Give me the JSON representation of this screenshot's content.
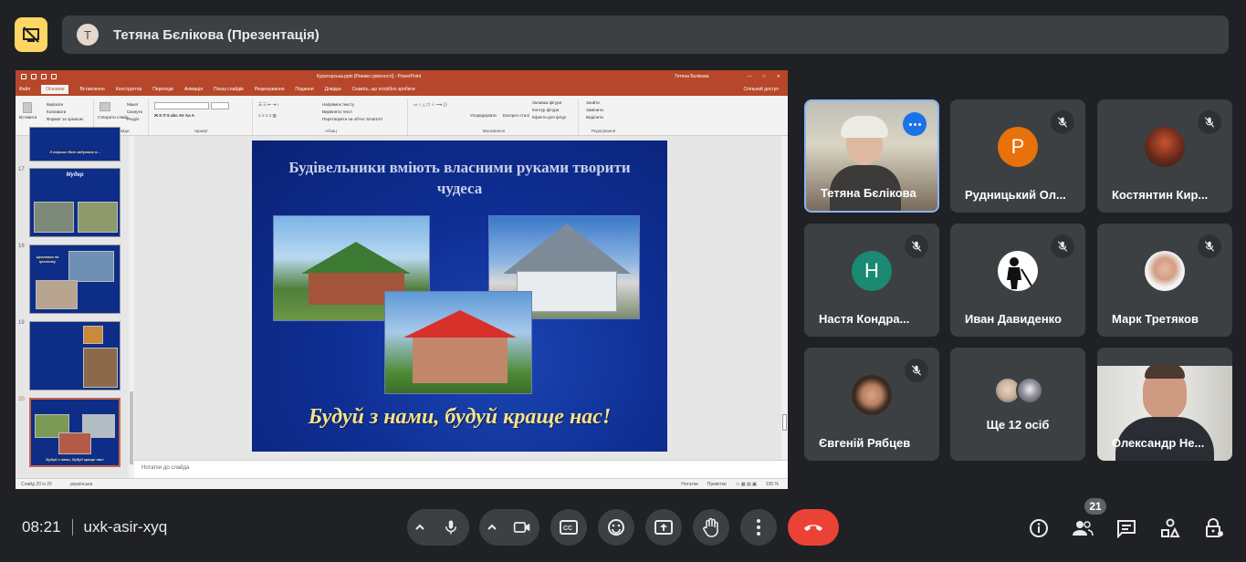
{
  "header": {
    "presenter_avatar_letter": "Т",
    "title": "Тетяна Бєлікова (Презентація)"
  },
  "powerpoint": {
    "doc_title": "Кураторська.pptx [Режим сумісності] - PowerPoint",
    "user": "Тетяна Бєлікова",
    "tabs": [
      "Файл",
      "Основне",
      "Вставлення",
      "Конструктор",
      "Переходи",
      "Анімація",
      "Показ слайдів",
      "Рецензування",
      "Подання",
      "Довідка",
      "Скажіть, що потрібно зробити"
    ],
    "share": "Спільний доступ",
    "ribbon": {
      "clipboard": {
        "paste": "Вставити",
        "cut": "Вирізати",
        "copy": "Копіювати",
        "format": "Формат за зразком",
        "label": "Буфер обміну"
      },
      "slides": {
        "new": "Створити слайд",
        "layout": "Макет",
        "reset": "Скинути",
        "section": "Розділ",
        "label": "Слайди"
      },
      "font": {
        "label": "Шрифт"
      },
      "paragraph": {
        "dir": "Напрямок тексту",
        "align": "Вирівняти текст",
        "smartart": "Перетворити на об'єкт SmartArt",
        "label": "Абзац"
      },
      "drawing": {
        "arrange": "Упорядкувати",
        "styles": "Експрес-стилі",
        "fill": "Заливка фігури",
        "outline": "Контур фігури",
        "effects": "Ефекти для фігур",
        "label": "Малювання"
      },
      "editing": {
        "find": "Знайти",
        "replace": "Замінити",
        "select": "Виділити",
        "label": "Редагування"
      }
    },
    "thumbnails": [
      {
        "num": "",
        "text": "З перших днів задумала я..."
      },
      {
        "num": "17",
        "text": "Мудер"
      },
      {
        "num": "18",
        "text": "Цеглянка на цеглянку"
      },
      {
        "num": "19",
        "text": ""
      },
      {
        "num": "20",
        "text": "Будуй з нами, будуй краще нас!"
      }
    ],
    "slide": {
      "title": "Будівельники вміють власними руками творити чудеса",
      "caption": "Будуй з нами, будуй краще нас!"
    },
    "notes": "Нотатки до слайда",
    "status": {
      "slide": "Слайд 20 із 20",
      "lang": "українська",
      "notes_btn": "Нотатки",
      "comments_btn": "Примітки",
      "zoom": "100 %"
    }
  },
  "participants": [
    {
      "name": "Тетяна Бєлікова",
      "type": "video",
      "active": true
    },
    {
      "name": "Рудницький Ол...",
      "type": "letter",
      "letter": "Р",
      "color": "#e8710a",
      "muted": true
    },
    {
      "name": "Костянтин Кир...",
      "type": "photo",
      "muted": true
    },
    {
      "name": "Настя Кондра...",
      "type": "letter",
      "letter": "Н",
      "color": "#1a8a72",
      "muted": true
    },
    {
      "name": "Иван Давиденко",
      "type": "photo",
      "muted": true
    },
    {
      "name": "Марк Третяков",
      "type": "photo",
      "muted": true
    },
    {
      "name": "Євгеній Рябцев",
      "type": "photo",
      "muted": true
    },
    {
      "name": "Ще 12 осіб",
      "type": "group"
    },
    {
      "name": "Олександр Не...",
      "type": "video"
    }
  ],
  "bottom_bar": {
    "time": "08:21",
    "meeting_code": "uxk-asir-xyq",
    "participants_count": "21"
  },
  "colors": {
    "background": "#202124",
    "tile": "#3c4043",
    "end_call": "#ea4335",
    "presenting_badge": "#fdd663",
    "active_border": "#8ab4f8",
    "ppt_accent": "#b7472a"
  }
}
